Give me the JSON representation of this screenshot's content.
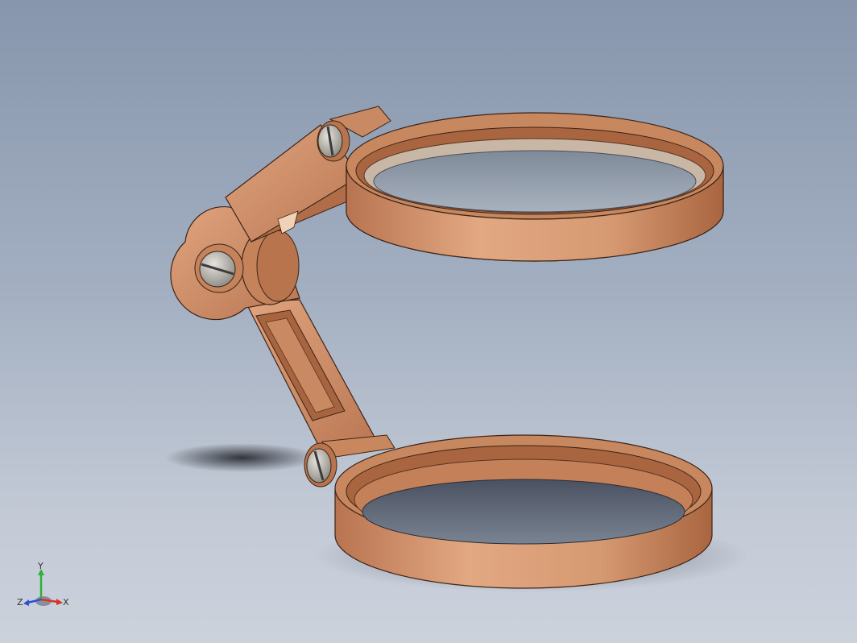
{
  "viewport": {
    "background_top": "#8796ad",
    "background_bottom": "#ccd2dc"
  },
  "model": {
    "material_color": "#d49a72",
    "shadow_color": "#2a2d33",
    "lens_color": "#5f6a7a"
  },
  "triad": {
    "x_label": "X",
    "y_label": "Y",
    "z_label": "Z",
    "x_color": "#d8332a",
    "y_color": "#2fae3a",
    "z_color": "#2d4fd6"
  }
}
